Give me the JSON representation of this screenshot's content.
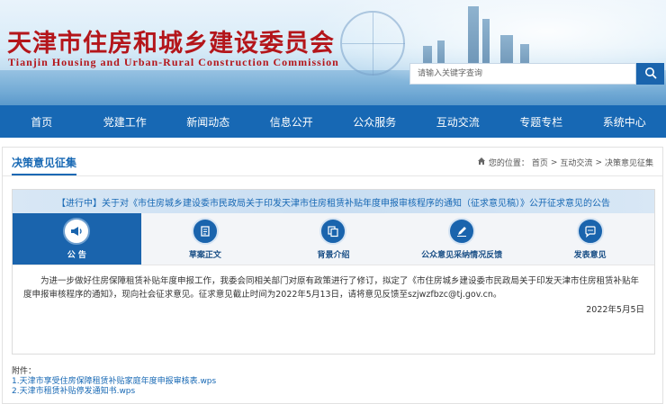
{
  "header": {
    "title_cn": "天津市住房和城乡建设委员会",
    "title_en": "Tianjin Housing and Urban-Rural Construction Commission",
    "search_placeholder": "请输入关键字查询",
    "search_icon": "search-icon"
  },
  "nav": {
    "items": [
      "首页",
      "党建工作",
      "新闻动态",
      "信息公开",
      "公众服务",
      "互动交流",
      "专题专栏",
      "系统中心"
    ]
  },
  "section": {
    "title": "决策意见征集",
    "breadcrumb": {
      "home_icon": "home-icon",
      "prefix": "您的位置：",
      "items": [
        "首页",
        "互动交流",
        "决策意见征集"
      ],
      "separator": ">"
    }
  },
  "notice": {
    "title": "【进行中】关于对《市住房城乡建设委市民政局关于印发天津市住房租赁补贴年度申报审核程序的通知（征求意见稿）》公开征求意见的公告",
    "tabs": [
      {
        "label": "公 告",
        "icon": "megaphone-icon",
        "active": true
      },
      {
        "label": "草案正文",
        "icon": "document-icon",
        "active": false
      },
      {
        "label": "背景介绍",
        "icon": "copy-icon",
        "active": false
      },
      {
        "label": "公众意见采纳情况反馈",
        "icon": "pen-icon",
        "active": false
      },
      {
        "label": "发表意见",
        "icon": "chat-icon",
        "active": false
      }
    ],
    "body": "为进一步做好住房保障租赁补贴年度申报工作，我委会同相关部门对原有政策进行了修订，拟定了《市住房城乡建设委市民政局关于印发天津市住房租赁补贴年度申报审核程序的通知》，现向社会征求意见。征求意见截止时间为2022年5月13日，请将意见反馈至szjwzfbzc@tj.gov.cn。",
    "date": "2022年5月5日"
  },
  "attachments": {
    "label": "附件：",
    "items": [
      "1.天津市享受住房保障租赁补贴家庭年度申报审核表.wps",
      "2.天津市租赁补贴停发通知书.wps"
    ]
  },
  "colors": {
    "primary": "#1768b4",
    "brand_red": "#b4161b"
  }
}
